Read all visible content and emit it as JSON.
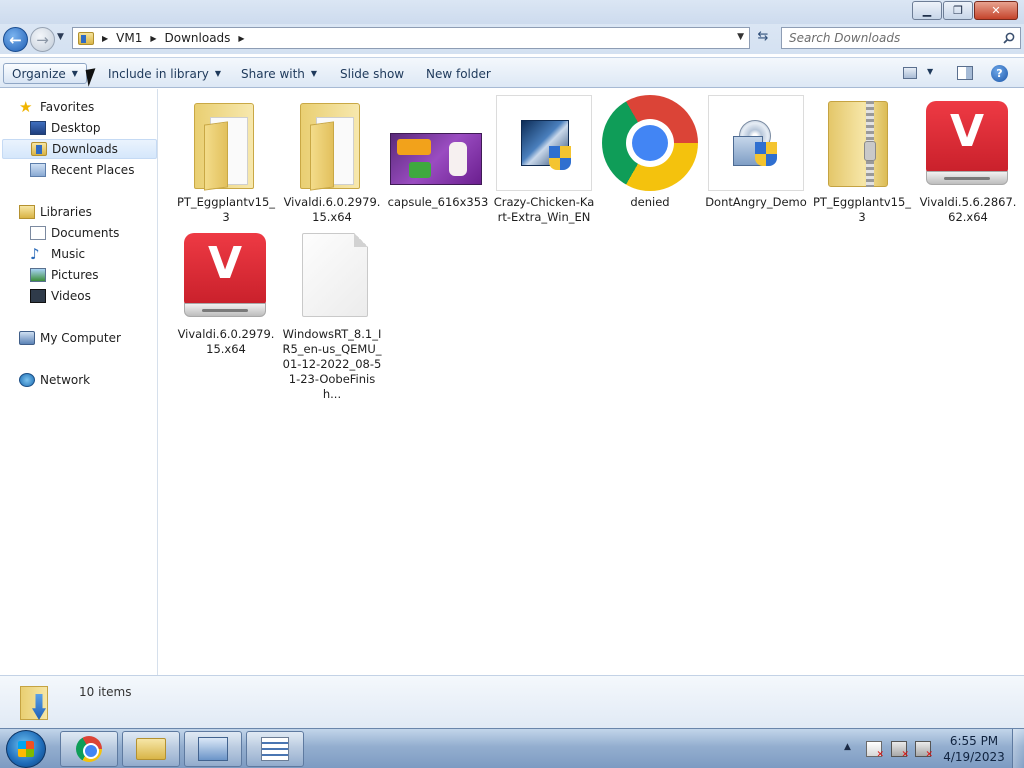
{
  "window": {
    "minimize_icon": "minimize-icon",
    "maximize_icon": "restore-icon",
    "close_icon": "close-icon"
  },
  "address": {
    "breadcrumb": [
      "VM1",
      "Downloads"
    ],
    "search_placeholder": "Search Downloads"
  },
  "toolbar": {
    "organize": "Organize",
    "include_in_library": "Include in library",
    "share_with": "Share with",
    "slide_show": "Slide show",
    "new_folder": "New folder"
  },
  "sidebar": {
    "favorites": {
      "label": "Favorites",
      "items": [
        {
          "label": "Desktop",
          "icon": "desktop-icon"
        },
        {
          "label": "Downloads",
          "icon": "downloads-icon"
        },
        {
          "label": "Recent Places",
          "icon": "recent-places-icon"
        }
      ]
    },
    "libraries": {
      "label": "Libraries",
      "items": [
        {
          "label": "Documents",
          "icon": "documents-icon"
        },
        {
          "label": "Music",
          "icon": "music-icon"
        },
        {
          "label": "Pictures",
          "icon": "pictures-icon"
        },
        {
          "label": "Videos",
          "icon": "videos-icon"
        }
      ]
    },
    "computer": {
      "label": "My Computer"
    },
    "network": {
      "label": "Network"
    }
  },
  "files": [
    {
      "name": "PT_Eggplantv15_3",
      "icon": "folder-icon"
    },
    {
      "name": "Vivaldi.6.0.2979.15.x64",
      "icon": "folder-icon"
    },
    {
      "name": "capsule_616x353",
      "icon": "image-thumbnail"
    },
    {
      "name": "Crazy-Chicken-Kart-Extra_Win_EN",
      "icon": "installer-icon"
    },
    {
      "name": "denied",
      "icon": "chrome-icon"
    },
    {
      "name": "DontAngry_Demo",
      "icon": "setup-icon"
    },
    {
      "name": "PT_Eggplantv15_3",
      "icon": "zip-folder-icon"
    },
    {
      "name": "Vivaldi.5.6.2867.62.x64",
      "icon": "vivaldi-installer-icon"
    },
    {
      "name": "Vivaldi.6.0.2979.15.x64",
      "icon": "vivaldi-installer-icon"
    },
    {
      "name": "WindowsRT_8.1_IR5_en-us_QEMU_01-12-2022_08-51-23-OobeFinish...",
      "icon": "blank-file-icon"
    }
  ],
  "status": {
    "item_count": "10 items"
  },
  "taskbar": {
    "time": "6:55 PM",
    "date": "4/19/2023"
  }
}
